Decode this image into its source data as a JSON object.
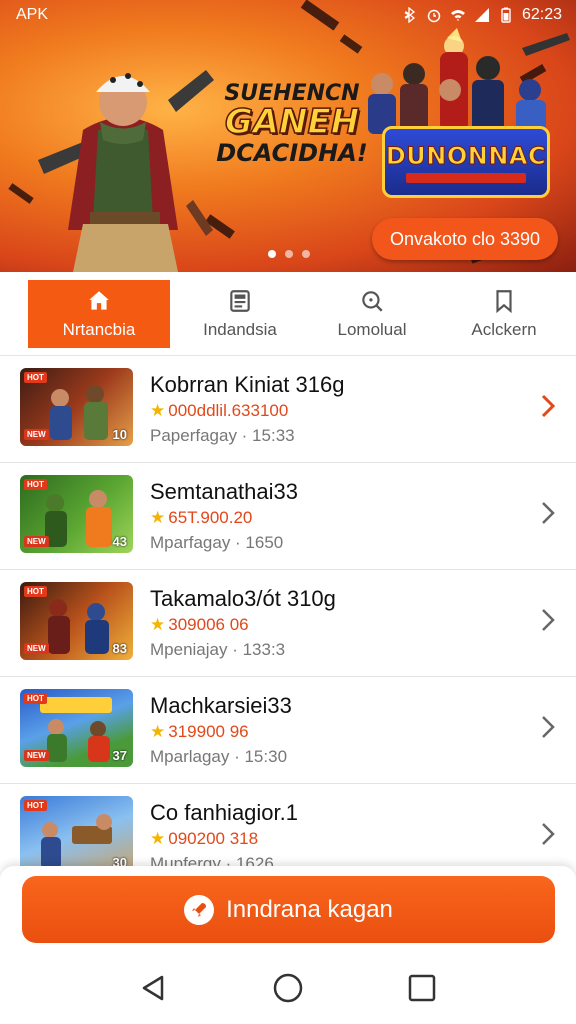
{
  "status_bar": {
    "left_label": "APK",
    "time": "62:23"
  },
  "banner": {
    "headline_line1": "SUEHENCN",
    "headline_line2": "GANEH",
    "headline_line3": "DCACIDHA!",
    "logo_text": "DUNONNAC",
    "promo_button": "Onvakoto clo 3390",
    "carousel_total": 3,
    "carousel_active": 1
  },
  "tabs": [
    {
      "label": "Nrtancbia",
      "icon": "home-icon",
      "active": true
    },
    {
      "label": "Indandsia",
      "icon": "news-icon",
      "active": false
    },
    {
      "label": "Lomolual",
      "icon": "search-icon",
      "active": false
    },
    {
      "label": "Aclckern",
      "icon": "bookmark-icon",
      "active": false
    }
  ],
  "games": [
    {
      "title": "Kobrran Kiniat 316g",
      "rating": "000ddlil.633100",
      "meta": "Paperfagay · 15:33",
      "badge": "10",
      "highlight": true
    },
    {
      "title": "Semtanathai33",
      "rating": "65T.900.20",
      "meta": "Mparfagay · 1650",
      "badge": "43",
      "highlight": false
    },
    {
      "title": "Takamalo3/ót 310g",
      "rating": "309006 06",
      "meta": "Mpeniajay · 133:3",
      "badge": "83",
      "highlight": false
    },
    {
      "title": "Machkarsiei33",
      "rating": "319900 96",
      "meta": "Mparlagay · 15:30",
      "badge": "37",
      "highlight": false
    },
    {
      "title": "Co fanhiagior.1",
      "rating": "090200 318",
      "meta": "Mupfergy · 1626",
      "badge": "30",
      "highlight": false
    }
  ],
  "cta": {
    "label": "Inndrana kagan"
  },
  "colors": {
    "accent": "#f55a13",
    "star": "#f4b400",
    "rating_text": "#e2481a"
  }
}
